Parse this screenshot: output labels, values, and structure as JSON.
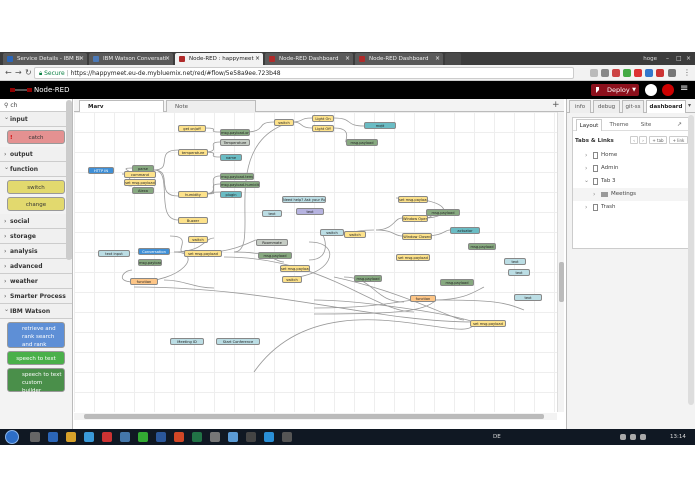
{
  "browser": {
    "tabs": [
      {
        "title": "Service Details - IBM Bl",
        "active": false
      },
      {
        "title": "IBM Watson Conversati",
        "active": false
      },
      {
        "title": "Node-RED : happymeet",
        "active": true
      },
      {
        "title": "Node-RED Dashboard",
        "active": false
      },
      {
        "title": "Node-RED Dashboard",
        "active": false
      }
    ],
    "user": "hoge",
    "secure_label": "Secure",
    "url": "https://happymeet.eu-de.mybluemix.net/red/#flow/5e58a9ee.723b48"
  },
  "header": {
    "title": "Node-RED",
    "deploy_label": "Deploy"
  },
  "palette": {
    "search_value": "ch",
    "categories": [
      {
        "name": "input",
        "nodes": [
          {
            "label": "catch"
          }
        ]
      },
      {
        "name": "output"
      },
      {
        "name": "function",
        "nodes": [
          {
            "label": "switch"
          },
          {
            "label": "change"
          }
        ]
      },
      {
        "name": "social"
      },
      {
        "name": "storage"
      },
      {
        "name": "analysis"
      },
      {
        "name": "advanced"
      },
      {
        "name": "weather"
      },
      {
        "name": "Smarter Process"
      },
      {
        "name": "IBM Watson",
        "nodes": [
          {
            "label": "retrieve and rank search and rank"
          },
          {
            "label": "speech to text"
          },
          {
            "label": "speech to text custom builder"
          }
        ]
      }
    ]
  },
  "workspace": {
    "tabs": [
      {
        "label": "Marv",
        "active": true
      },
      {
        "label": "Note",
        "active": false
      }
    ],
    "add_tab": "+",
    "nodes": [
      {
        "label": "get on/off",
        "kind": "func"
      },
      {
        "label": "msg.payload.on",
        "kind": "out"
      },
      {
        "label": "temperature",
        "kind": "func"
      },
      {
        "label": "Temperature",
        "kind": "watson"
      },
      {
        "label": "name",
        "kind": "teal"
      },
      {
        "label": "humidity",
        "kind": "func"
      },
      {
        "label": "msg.payload.temp",
        "kind": "out"
      },
      {
        "label": "msg.payload.humidity",
        "kind": "out"
      },
      {
        "label": "plugin",
        "kind": "teal"
      },
      {
        "label": "Buzzer",
        "kind": "func"
      },
      {
        "label": "HTTP IN",
        "kind": "blu"
      },
      {
        "label": "parse",
        "kind": "out"
      },
      {
        "label": "command",
        "kind": "func"
      },
      {
        "label": "set msg.payload",
        "kind": "func"
      },
      {
        "label": "Alexa",
        "kind": "out"
      },
      {
        "label": "switch",
        "kind": "func"
      },
      {
        "label": "Light On",
        "kind": "func"
      },
      {
        "label": "Light Off",
        "kind": "func"
      },
      {
        "label": "mqtt",
        "kind": "teal"
      },
      {
        "label": "msg.payload",
        "kind": "out"
      },
      {
        "label": "Need help? Ask your Roommate!",
        "kind": "inj"
      },
      {
        "label": "text",
        "kind": "inj"
      },
      {
        "label": "text",
        "kind": "purple"
      },
      {
        "label": "set msg.payload",
        "kind": "func"
      },
      {
        "label": "msg.payload",
        "kind": "out"
      },
      {
        "label": "Window Open",
        "kind": "func"
      },
      {
        "label": "Window Closed",
        "kind": "func"
      },
      {
        "label": "actuator",
        "kind": "teal"
      },
      {
        "label": "switch",
        "kind": "func"
      },
      {
        "label": "switch",
        "kind": "inj"
      },
      {
        "label": "msg.payload",
        "kind": "out"
      },
      {
        "label": "text input",
        "kind": "inj"
      },
      {
        "label": "Conversation",
        "kind": "blu"
      },
      {
        "label": "msg.payload",
        "kind": "out"
      },
      {
        "label": "switch",
        "kind": "func"
      },
      {
        "label": "set msg.payload",
        "kind": "func"
      },
      {
        "label": "Roommate",
        "kind": "watson"
      },
      {
        "label": "msg.payload",
        "kind": "out"
      },
      {
        "label": "set msg.payload",
        "kind": "func"
      },
      {
        "label": "set msg.payload",
        "kind": "func"
      },
      {
        "label": "msg.payload",
        "kind": "out"
      },
      {
        "label": "text",
        "kind": "inj"
      },
      {
        "label": "text",
        "kind": "inj"
      },
      {
        "label": "switch",
        "kind": "func"
      },
      {
        "label": "function",
        "kind": "orange"
      },
      {
        "label": "msg.payload",
        "kind": "out"
      },
      {
        "label": "function",
        "kind": "orange"
      },
      {
        "label": "text",
        "kind": "inj"
      },
      {
        "label": "set msg.payload",
        "kind": "func"
      },
      {
        "label": "Meeting ID",
        "kind": "inj"
      },
      {
        "label": "Start Conference",
        "kind": "inj"
      }
    ]
  },
  "sidebar": {
    "tabs": [
      {
        "label": "info",
        "active": false
      },
      {
        "label": "debug",
        "active": false
      },
      {
        "label": "git-ss",
        "active": false
      },
      {
        "label": "dashboard",
        "active": true
      }
    ],
    "subtabs": [
      {
        "label": "Layout",
        "active": true
      },
      {
        "label": "Theme",
        "active": false
      },
      {
        "label": "Site",
        "active": false
      }
    ],
    "section_title": "Tabs & Links",
    "buttons": [
      "+ tab",
      "+ link"
    ],
    "tree": [
      {
        "label": "Home",
        "depth": 0,
        "expanded": false
      },
      {
        "label": "Admin",
        "depth": 0,
        "expanded": false
      },
      {
        "label": "Tab 3",
        "depth": 0,
        "expanded": true
      },
      {
        "label": "Meetings",
        "depth": 1,
        "expanded": false
      },
      {
        "label": "Trash",
        "depth": 0,
        "expanded": false
      }
    ]
  },
  "taskbar": {
    "lang": "DE",
    "time": "13:14"
  },
  "colors": {
    "deploy": "#8c101c",
    "header": "#000000",
    "function_node": "#fde28b",
    "output_node": "#87a980",
    "watson_node": "#c5ccc4",
    "http_node": "#3f8fd6"
  }
}
